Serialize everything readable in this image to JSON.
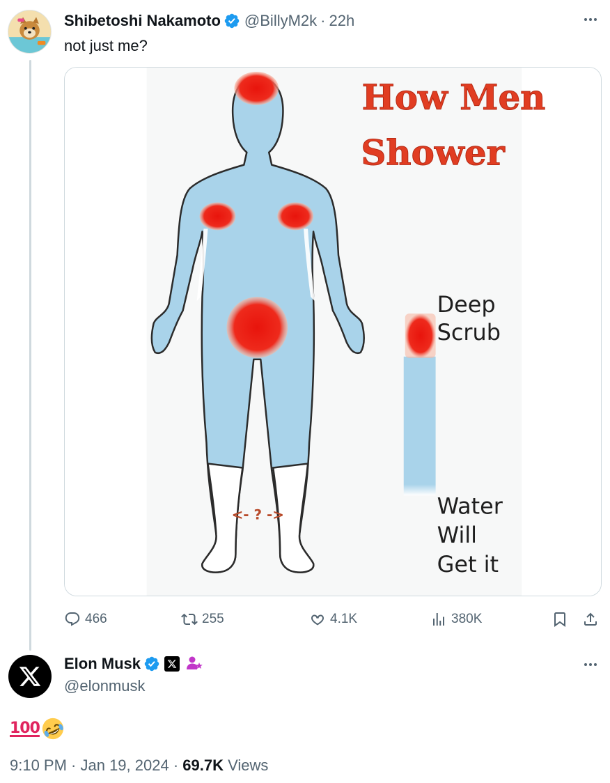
{
  "parent_tweet": {
    "display_name": "Shibetoshi Nakamoto",
    "handle": "@BillyM2k",
    "time_sep": "·",
    "time": "22h",
    "text": "not just me?",
    "media": {
      "title_line1": "How Men",
      "title_line2": "Shower",
      "label_deep": "Deep",
      "label_scrub": "Scrub",
      "label_water": "Water",
      "label_will": "Will",
      "label_getit": "Get it",
      "label_question": "<- ? ->"
    },
    "actions": {
      "replies": "466",
      "retweets": "255",
      "likes": "4.1K",
      "views": "380K"
    }
  },
  "reply_tweet": {
    "display_name": "Elon Musk",
    "handle": "@elonmusk",
    "emoji_100": "100",
    "timestamp": "9:10 PM · Jan 19, 2024 ·",
    "views_count": "69.7K",
    "views_label": "Views"
  },
  "colors": {
    "text_primary": "#0f1419",
    "text_secondary": "#536471",
    "verified_blue": "#1d9bf0",
    "thread_line": "#cfd9de",
    "body_blue": "#a9d3ea",
    "scrub_red": "#e8261c"
  },
  "icons": [
    "verified-badge-icon",
    "more-icon",
    "reply-icon",
    "retweet-icon",
    "like-icon",
    "views-icon",
    "bookmark-icon",
    "share-icon",
    "x-logo-icon",
    "affiliate-icon",
    "rofl-emoji-icon"
  ]
}
